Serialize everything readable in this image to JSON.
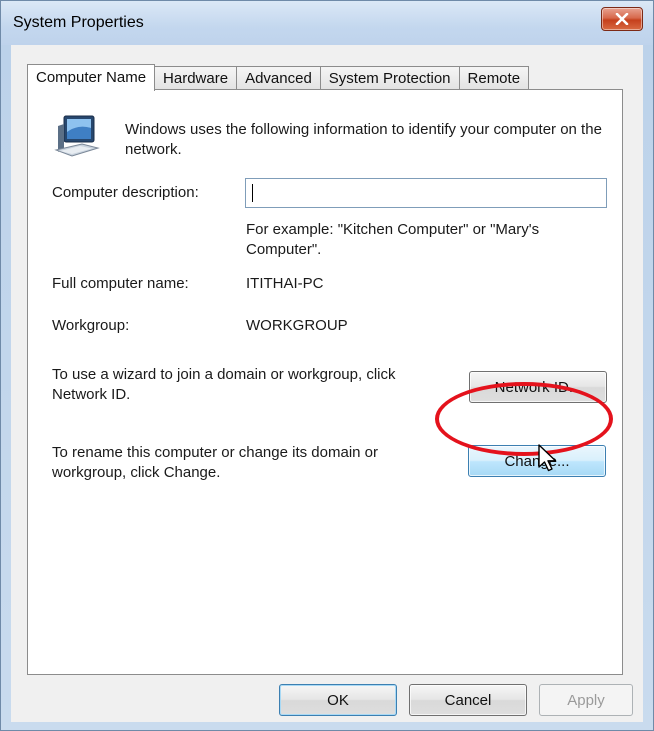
{
  "window": {
    "title": "System Properties",
    "close_icon": "close-icon"
  },
  "tabs": [
    {
      "label": "Computer Name",
      "active": true
    },
    {
      "label": "Hardware",
      "active": false
    },
    {
      "label": "Advanced",
      "active": false
    },
    {
      "label": "System Protection",
      "active": false
    },
    {
      "label": "Remote",
      "active": false
    }
  ],
  "computer_name": {
    "icon": "computer-icon",
    "intro_text": "Windows uses the following information to identify your computer on the network.",
    "description_label": "Computer description:",
    "description_value": "",
    "example_text": "For example: \"Kitchen Computer\" or \"Mary's Computer\".",
    "full_name_label": "Full computer name:",
    "full_name_value": "ITITHAI-PC",
    "workgroup_label": "Workgroup:",
    "workgroup_value": "WORKGROUP",
    "network_id_text": "To use a wizard to join a domain or workgroup, click Network ID.",
    "network_id_button": "Network ID...",
    "rename_text": "To rename this computer or change its domain or workgroup, click Change.",
    "change_button": "Change..."
  },
  "footer": {
    "ok_label": "OK",
    "cancel_label": "Cancel",
    "apply_label": "Apply"
  },
  "annotation": {
    "highlight_color": "#e4121c"
  }
}
